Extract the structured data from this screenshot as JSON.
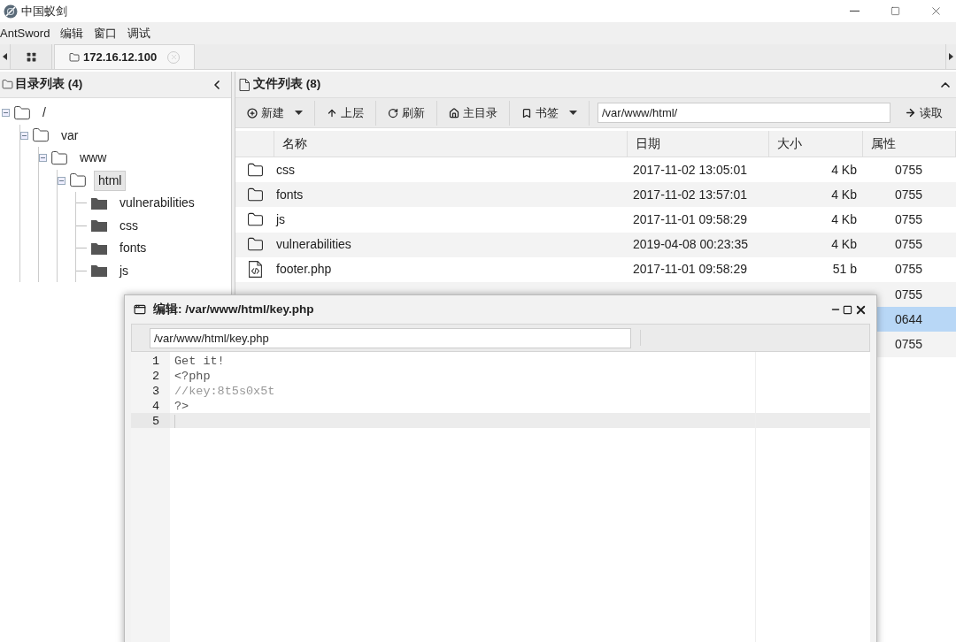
{
  "window": {
    "title": "中国蚁剑"
  },
  "menu": [
    "AntSword",
    "编辑",
    "窗口",
    "调试"
  ],
  "tabs": [
    {
      "kind": "grid",
      "selected": false
    },
    {
      "kind": "host",
      "label": "172.16.12.100",
      "selected": true
    }
  ],
  "tree_panel": {
    "title": "目录列表 (4)",
    "items": [
      {
        "name": "/",
        "expanded": true,
        "selected": false,
        "children": [
          {
            "name": "var",
            "expanded": true,
            "selected": false,
            "children": [
              {
                "name": "www",
                "expanded": true,
                "selected": false,
                "children": [
                  {
                    "name": "html",
                    "expanded": true,
                    "selected": true,
                    "children": [
                      {
                        "name": "vulnerabilities",
                        "selected": false
                      },
                      {
                        "name": "css",
                        "selected": false
                      },
                      {
                        "name": "fonts",
                        "selected": false
                      },
                      {
                        "name": "js",
                        "selected": false
                      }
                    ]
                  }
                ]
              }
            ]
          }
        ]
      }
    ]
  },
  "file_panel": {
    "title": "文件列表 (8)",
    "toolbar": [
      {
        "kind": "new",
        "label": "新建",
        "dropdown": true
      },
      {
        "kind": "up",
        "label": "上层",
        "dropdown": false
      },
      {
        "kind": "refresh",
        "label": "刷新",
        "dropdown": false
      },
      {
        "kind": "home",
        "label": "主目录",
        "dropdown": false
      },
      {
        "kind": "bookmark",
        "label": "书签",
        "dropdown": true
      }
    ],
    "path": "/var/www/html/",
    "read_button": "读取",
    "columns": [
      "名称",
      "日期",
      "大小",
      "属性"
    ],
    "rows": [
      {
        "kind": "folder",
        "name": "css",
        "date": "2017-11-02 13:05:01",
        "size": "4 Kb",
        "attr": "0755",
        "selected": false
      },
      {
        "kind": "folder",
        "name": "fonts",
        "date": "2017-11-02 13:57:01",
        "size": "4 Kb",
        "attr": "0755",
        "selected": false
      },
      {
        "kind": "folder",
        "name": "js",
        "date": "2017-11-01 09:58:29",
        "size": "4 Kb",
        "attr": "0755",
        "selected": false
      },
      {
        "kind": "folder",
        "name": "vulnerabilities",
        "date": "2019-04-08 00:23:35",
        "size": "4 Kb",
        "attr": "0755",
        "selected": false
      },
      {
        "kind": "file",
        "name": "footer.php",
        "date": "2017-11-01 09:58:29",
        "size": "51 b",
        "attr": "0755",
        "selected": false
      },
      {
        "attr": "0755",
        "selected": false
      },
      {
        "attr": "0644",
        "selected": true
      },
      {
        "attr": "0755",
        "selected": false
      }
    ]
  },
  "editor": {
    "title": "编辑: /var/www/html/key.php",
    "path": "/var/www/html/key.php",
    "lines": [
      {
        "number": "1",
        "text": "Get it!",
        "kind": "plain",
        "active": false
      },
      {
        "number": "2",
        "text": "<?php",
        "kind": "plain",
        "active": false
      },
      {
        "number": "3",
        "text": "//key:8t5s0x5t",
        "kind": "comment",
        "active": false
      },
      {
        "number": "4",
        "text": "?>",
        "kind": "plain",
        "active": false
      },
      {
        "number": "5",
        "kind": "plain",
        "active": true
      }
    ]
  }
}
